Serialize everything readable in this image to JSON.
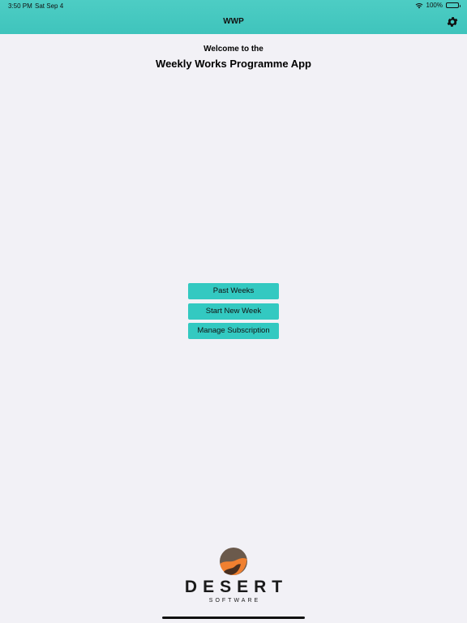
{
  "status_bar": {
    "time": "3:50 PM",
    "date": "Sat Sep 4",
    "battery": "100%",
    "icons": [
      "wifi-icon",
      "battery-icon"
    ]
  },
  "nav": {
    "title": "WWP",
    "settings_icon": "gear-icon"
  },
  "welcome": {
    "line1": "Welcome to the",
    "line2": "Weekly Works Programme App"
  },
  "buttons": {
    "past_weeks": "Past Weeks",
    "start_new_week": "Start New Week",
    "manage_subscription": "Manage Subscription"
  },
  "logo": {
    "name": "DESERT",
    "subtitle": "SOFTWARE"
  },
  "colors": {
    "header": "#45c9c0",
    "button": "#33c9c1",
    "background": "#f2f1f6",
    "logo_brown": "#6b5140",
    "logo_orange": "#f08030"
  }
}
